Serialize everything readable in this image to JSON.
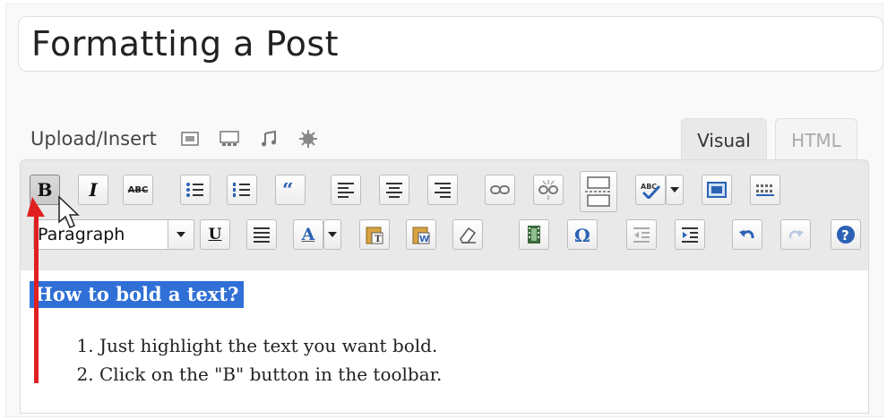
{
  "post": {
    "title": "Formatting a Post"
  },
  "media": {
    "upload_label": "Upload/Insert",
    "icons": [
      "image-icon",
      "video-icon",
      "audio-icon",
      "media-icon"
    ]
  },
  "tabs": {
    "visual": "Visual",
    "html": "HTML"
  },
  "toolbar": {
    "row1": [
      "bold",
      "italic",
      "strikethrough",
      "bulleted-list",
      "numbered-list",
      "blockquote",
      "align-left",
      "align-center",
      "align-right",
      "insert-link",
      "remove-link",
      "insert-more",
      "spellcheck",
      "fullscreen",
      "toggle-kitchen-sink"
    ],
    "row2": [
      "format-select",
      "underline",
      "justify",
      "text-color",
      "paste-text",
      "paste-word",
      "remove-format",
      "insert-media",
      "special-character",
      "outdent",
      "indent",
      "undo",
      "redo",
      "help"
    ],
    "bold_label": "B",
    "italic_label": "I",
    "strike_label": "ABC",
    "underline_label": "U",
    "textcolor_label": "A",
    "format_value": "Paragraph"
  },
  "editor": {
    "heading": "How to bold a text?",
    "steps": [
      "Just highlight the text you want bold.",
      "Click on the \"B\" button in the toolbar."
    ]
  },
  "colors": {
    "highlight": "#2f6fd6",
    "annotation_arrow": "#e02020"
  }
}
